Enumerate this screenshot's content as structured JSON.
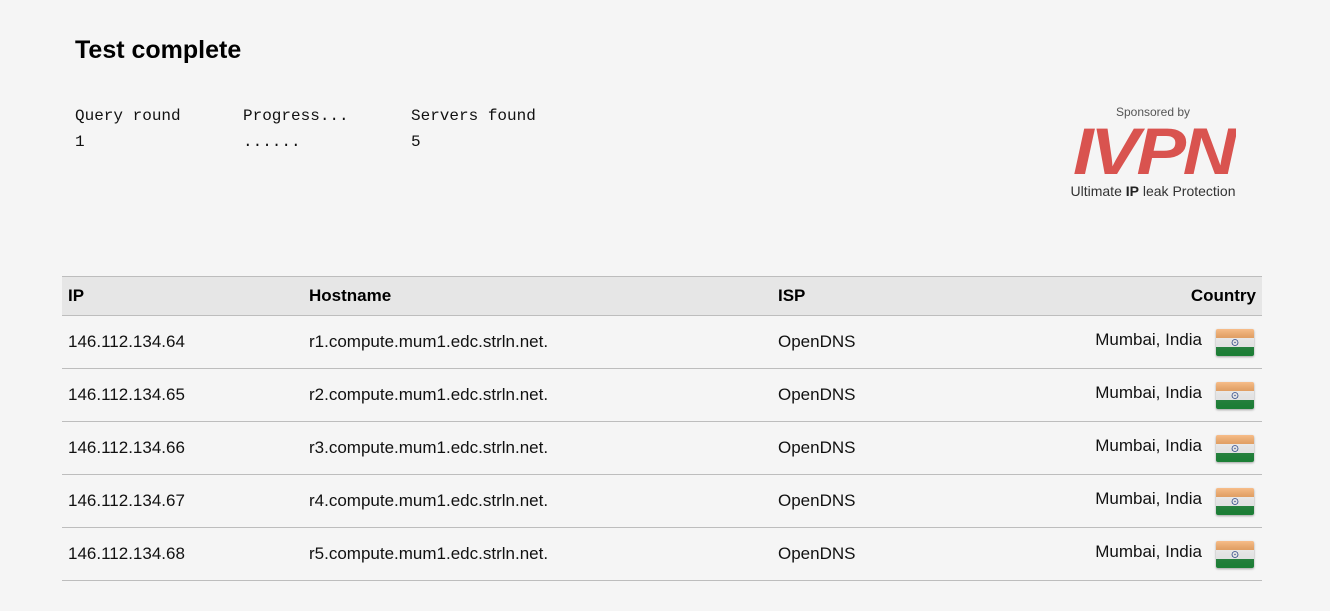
{
  "header": {
    "title": "Test complete"
  },
  "status": {
    "query_round_label": "Query round",
    "query_round_value": "1",
    "progress_label": "Progress...",
    "progress_value": "......",
    "servers_found_label": "Servers found",
    "servers_found_value": "5"
  },
  "sponsor": {
    "sponsored_by": "Sponsored by",
    "logo_text": "IVPN",
    "tagline_pre": "Ultimate ",
    "tagline_bold": "IP",
    "tagline_post": " leak Protection",
    "logo_color": "#d9534f"
  },
  "table": {
    "headers": {
      "ip": "IP",
      "hostname": "Hostname",
      "isp": "ISP",
      "country": "Country"
    },
    "rows": [
      {
        "ip": "146.112.134.64",
        "hostname": "r1.compute.mum1.edc.strln.net.",
        "isp": "OpenDNS",
        "country": "Mumbai, India",
        "flag": "india-flag-icon"
      },
      {
        "ip": "146.112.134.65",
        "hostname": "r2.compute.mum1.edc.strln.net.",
        "isp": "OpenDNS",
        "country": "Mumbai, India",
        "flag": "india-flag-icon"
      },
      {
        "ip": "146.112.134.66",
        "hostname": "r3.compute.mum1.edc.strln.net.",
        "isp": "OpenDNS",
        "country": "Mumbai, India",
        "flag": "india-flag-icon"
      },
      {
        "ip": "146.112.134.67",
        "hostname": "r4.compute.mum1.edc.strln.net.",
        "isp": "OpenDNS",
        "country": "Mumbai, India",
        "flag": "india-flag-icon"
      },
      {
        "ip": "146.112.134.68",
        "hostname": "r5.compute.mum1.edc.strln.net.",
        "isp": "OpenDNS",
        "country": "Mumbai, India",
        "flag": "india-flag-icon"
      }
    ]
  },
  "colors": {
    "background": "#f5f5f5",
    "header_row": "#e6e6e6",
    "row_border": "#bdbdbd",
    "flag_saffron": "#f39a4a",
    "flag_white": "#ffffff",
    "flag_green": "#1e8a3a",
    "flag_chakra": "#1a3a8a"
  }
}
